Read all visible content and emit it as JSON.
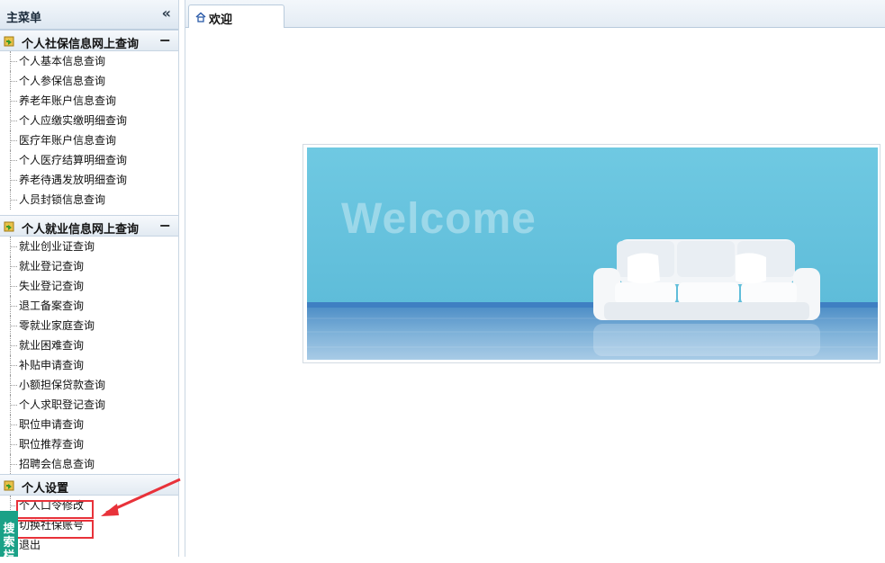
{
  "sidebar": {
    "title": "主菜单",
    "collapse_glyph": "«",
    "groups": [
      {
        "title": "个人社保信息网上查询",
        "toggle": "−",
        "items": [
          "个人基本信息查询",
          "个人参保信息查询",
          "养老年账户信息查询",
          "个人应缴实缴明细查询",
          "医疗年账户信息查询",
          "个人医疗结算明细查询",
          "养老待遇发放明细查询",
          "人员封锁信息查询"
        ]
      },
      {
        "title": "个人就业信息网上查询",
        "toggle": "−",
        "items": [
          "就业创业证查询",
          "就业登记查询",
          "失业登记查询",
          "退工备案查询",
          "零就业家庭查询",
          "就业困难查询",
          "补贴申请查询",
          "小额担保贷款查询",
          "个人求职登记查询",
          "职位申请查询",
          "职位推荐查询",
          "招聘会信息查询"
        ]
      },
      {
        "title": "个人设置",
        "items": [
          "个人口令修改",
          "切换社保账号",
          "退出"
        ]
      }
    ],
    "search_tab": "搜索栏"
  },
  "tabs": [
    {
      "label": "欢迎",
      "icon": "home-icon"
    }
  ],
  "banner": {
    "text": "Welcome"
  },
  "colors": {
    "highlight": "#e8323a",
    "search_tab_bg": "#1aa187",
    "banner_sky": "#6cc6e0"
  }
}
